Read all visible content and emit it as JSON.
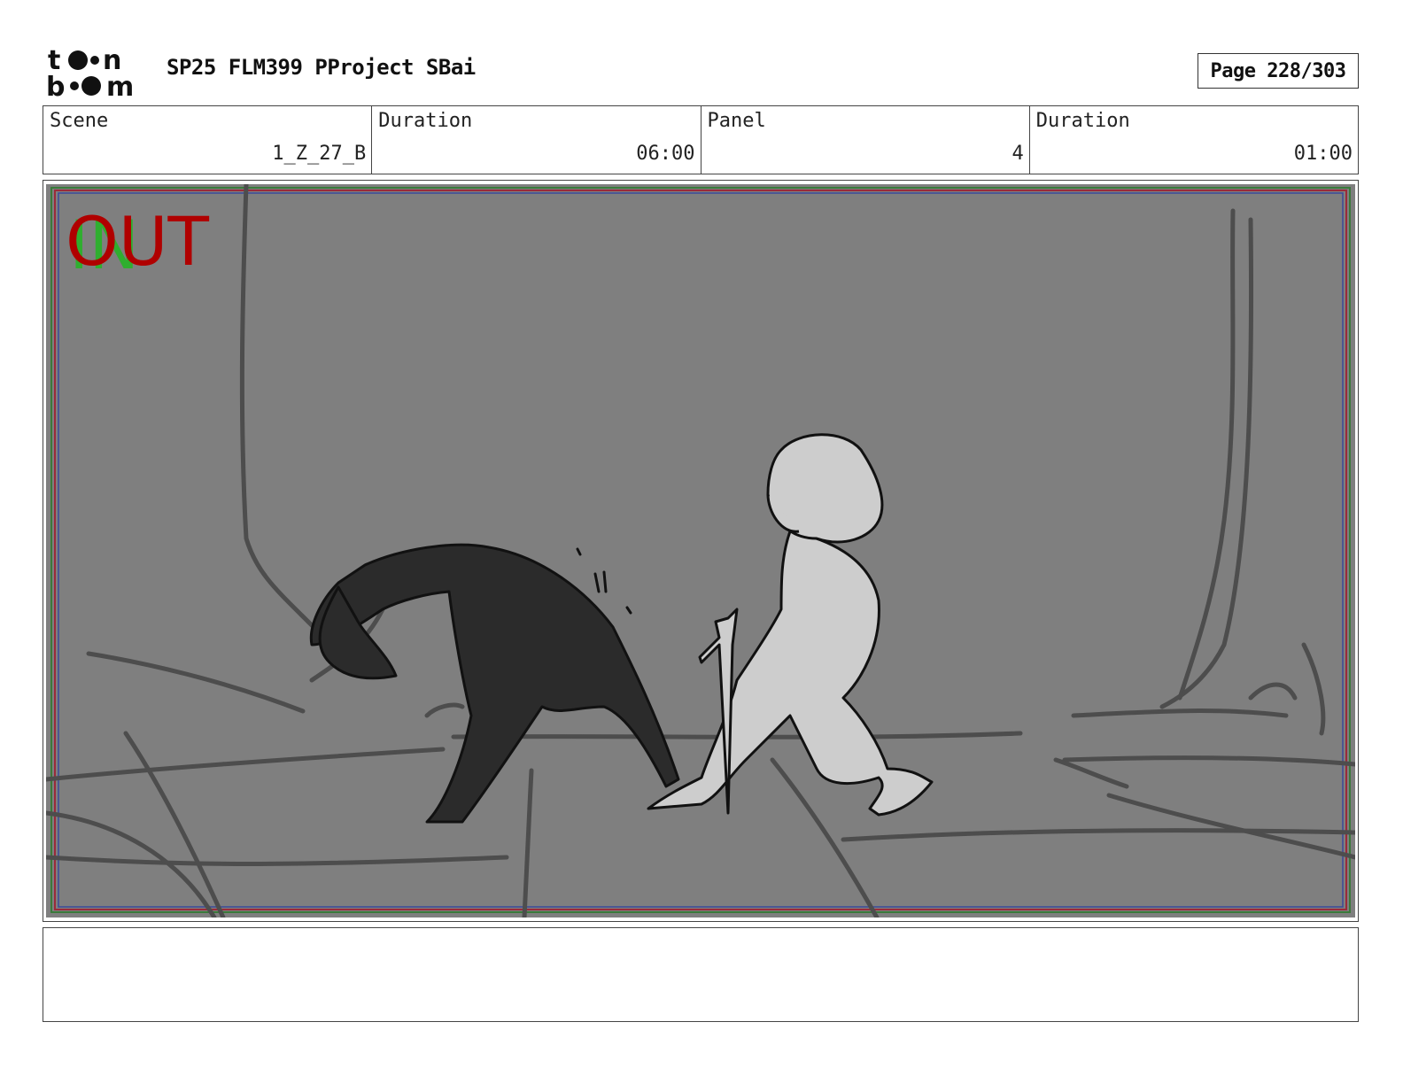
{
  "header": {
    "project_title": "SP25 FLM399 PProject SBai",
    "page_label": "Page 228/303",
    "logo_text": "toon boom"
  },
  "info": {
    "scene_label": "Scene",
    "scene_value": "1_Z_27_B",
    "scene_duration_label": "Duration",
    "scene_duration_value": "06:00",
    "panel_label": "Panel",
    "panel_value": "4",
    "panel_duration_label": "Duration",
    "panel_duration_value": "01:00"
  },
  "panel": {
    "in_marker": "IN",
    "out_marker": "OUT",
    "colors": {
      "background": "#7f7f7f",
      "out": "#b00000",
      "in": "#2fae2f",
      "wolf": "#2b2b2b",
      "figure": "#cdcdcd"
    }
  },
  "notes": {
    "text": ""
  }
}
